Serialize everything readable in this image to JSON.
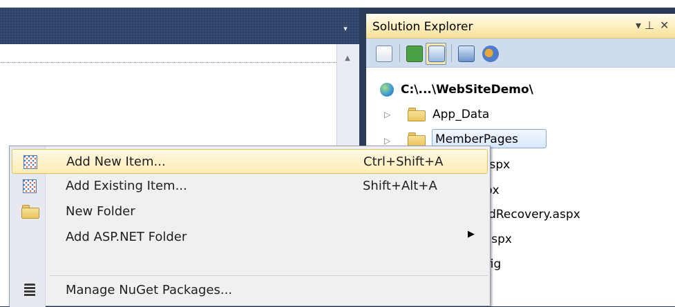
{
  "ide": {
    "tab_dropdown_glyph": "▾",
    "scroll_up_glyph": "▲"
  },
  "solution_explorer": {
    "title": "Solution Explorer",
    "pin_glyph": "▾ ⊥",
    "close_glyph": "✕",
    "toolbar_icons": [
      "properties-icon",
      "refresh-icon",
      "nest-related-files-icon",
      "view-designer-icon",
      "aspnet-configuration-icon"
    ],
    "tree": {
      "root": "C:\\...\\WebSiteDemo\\",
      "items": [
        {
          "label": "App_Data",
          "type": "folder",
          "expandable": true
        },
        {
          "label": "MemberPages",
          "type": "folder",
          "expandable": true,
          "selected": true
        },
        {
          "label": "t.aspx",
          "type": "file"
        },
        {
          "label": "spx",
          "type": "file"
        },
        {
          "label": "ordRecovery.aspx",
          "type": "file"
        },
        {
          "label": "r.aspx",
          "type": "file"
        },
        {
          "label": "nfig",
          "type": "file"
        }
      ]
    }
  },
  "context_menu": {
    "items": [
      {
        "label": "Add New Item...",
        "shortcut": "Ctrl+Shift+A",
        "icon": "add-new-item-icon",
        "highlighted": true
      },
      {
        "label": "Add Existing Item...",
        "shortcut": "Shift+Alt+A",
        "icon": "add-existing-item-icon"
      },
      {
        "label": "New Folder",
        "shortcut": "",
        "icon": "new-folder-icon"
      },
      {
        "label": "Add ASP.NET Folder",
        "shortcut": "",
        "icon": "",
        "submenu": true
      },
      {
        "label": "Manage NuGet Packages...",
        "shortcut": "",
        "icon": "nuget-icon"
      }
    ],
    "submenu_glyph": "▶"
  },
  "colors": {
    "ide_background": "#2b3c59",
    "highlight_bg": "#fdecb3",
    "selection_border": "#84acdd"
  }
}
